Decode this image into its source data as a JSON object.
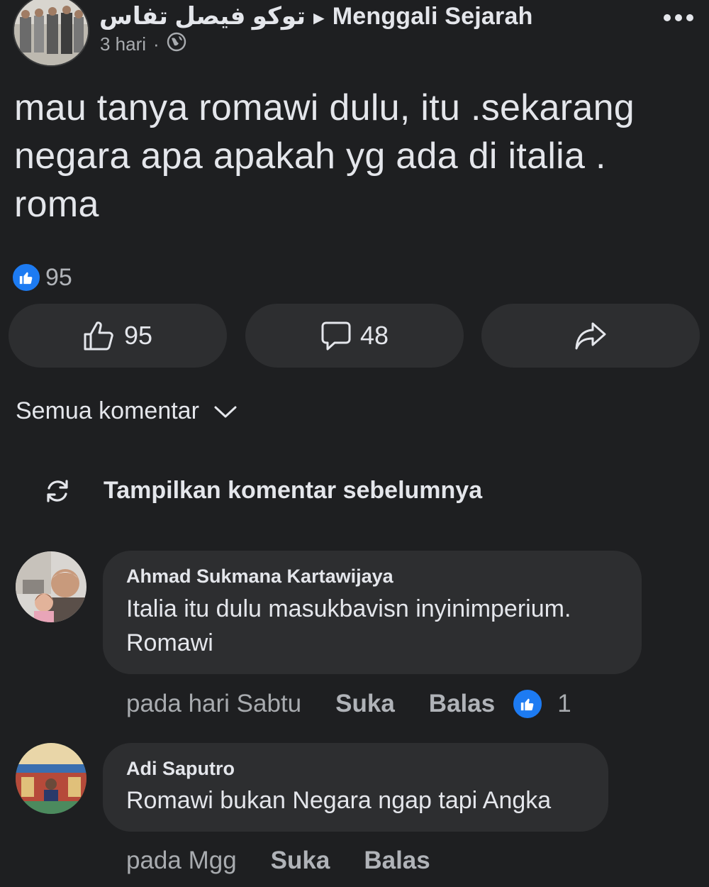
{
  "header": {
    "author": "توكو فيصل تفاس",
    "group": "Menggali Sejarah",
    "time": "3 hari",
    "separator": "·"
  },
  "post": {
    "text_lines": [
      "mau tanya romawi dulu, itu .sekarang",
      "negara apa apakah yg ada di italia .",
      "roma"
    ],
    "reaction_count": "95"
  },
  "actions": {
    "like_count": "95",
    "comment_count": "48"
  },
  "filter_label": "Semua komentar",
  "prev_comments_label": "Tampilkan komentar sebelumnya",
  "comments": [
    {
      "author": "Ahmad Sukmana Kartawijaya",
      "text_lines": [
        "Italia itu dulu masukbavisn inyinimperium.",
        "Romawi"
      ],
      "time": "pada hari Sabtu",
      "like_label": "Suka",
      "reply_label": "Balas",
      "reaction_count": "1"
    },
    {
      "author": "Adi Saputro",
      "text_lines": [
        "Romawi bukan Negara ngap tapi Angka"
      ],
      "time": "pada Mgg",
      "like_label": "Suka",
      "reply_label": "Balas"
    }
  ],
  "colors": {
    "background": "#1e1f21",
    "surface": "#2d2e30",
    "text": "#e4e6eb",
    "muted": "#a8abaf",
    "like_blue": "#1d7bf2"
  }
}
